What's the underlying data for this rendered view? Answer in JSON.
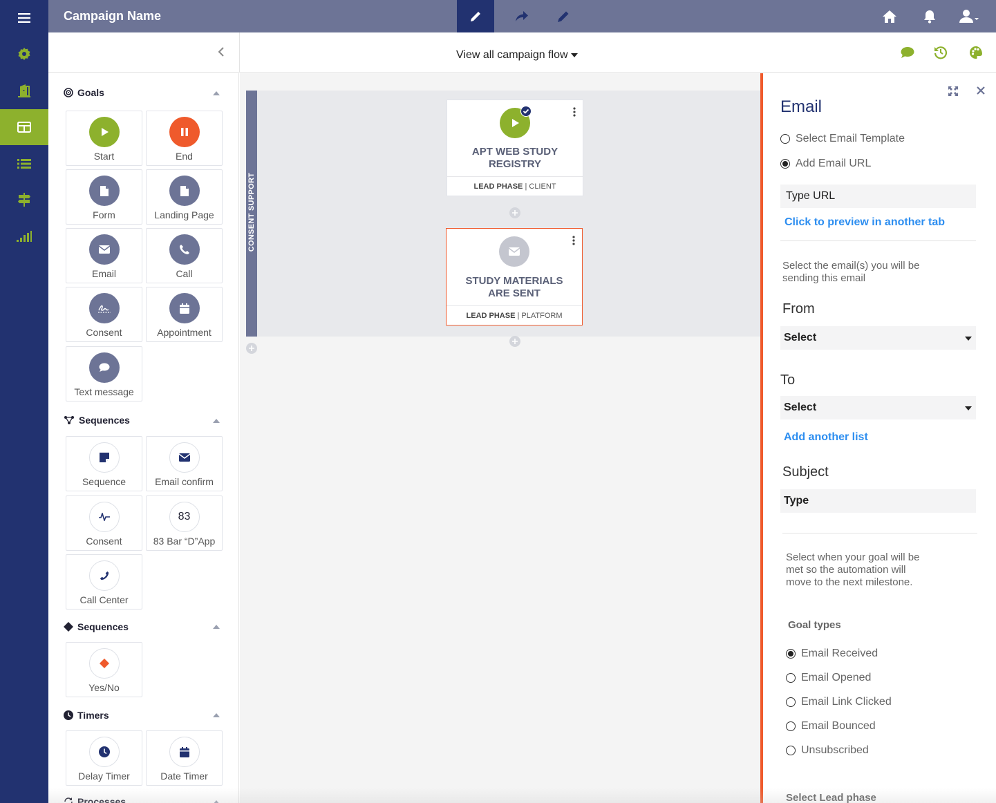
{
  "app": {
    "campaign_name": "Campaign Name",
    "accent_green": "#8db12d",
    "accent_orange": "#ef5a2c",
    "navy": "#223270"
  },
  "rail": {
    "items": [
      "menu-icon",
      "gear-icon",
      "door-icon",
      "board-icon",
      "list-icon",
      "signpost-icon",
      "signal-icon"
    ],
    "active": "board-icon"
  },
  "topbar": {
    "tools": [
      "pencil-icon",
      "share-icon",
      "pen-icon"
    ],
    "right_icons": [
      "home-icon",
      "bell-icon",
      "user-icon"
    ]
  },
  "subheader": {
    "flow_select": "View all campaign flow",
    "right_icons": [
      "comment-icon",
      "history-icon",
      "palette-icon"
    ]
  },
  "sidebar": {
    "goals": {
      "title": "Goals",
      "tiles": [
        "Start",
        "End",
        "Form",
        "Landing Page",
        "Email",
        "Call",
        "Consent",
        "Appointment",
        "Text message"
      ]
    },
    "sequences": {
      "title": "Sequences",
      "tiles": [
        "Sequence",
        "Email confirm",
        "Consent",
        "83 Bar “D”App",
        "Call Center"
      ],
      "badge_83": "83"
    },
    "decisions": {
      "title": "Sequences",
      "tiles": [
        "Yes/No"
      ]
    },
    "timers": {
      "title": "Timers",
      "tiles": [
        "Delay Timer",
        "Date Timer"
      ]
    },
    "processes": {
      "title": "Processes"
    }
  },
  "canvas": {
    "lane_label": "CONSENT SUPPORT",
    "nodes": [
      {
        "title": "APT WEB STUDY REGISTRY",
        "phase": "LEAD PHASE",
        "owner": "CLIENT"
      },
      {
        "title": "STUDY MATERIALS ARE SENT",
        "phase": "LEAD PHASE",
        "owner": "PLATFORM"
      }
    ],
    "separator": "|"
  },
  "panel": {
    "title": "Email",
    "source_options": [
      "Select Email Template",
      "Add Email URL"
    ],
    "selected_source": "Add Email URL",
    "url_field": "Type URL",
    "preview_link": "Click to preview in another tab",
    "select_help": "Select the email(s) you will be sending this email",
    "from_label": "From",
    "from_value": "Select",
    "to_label": "To",
    "to_value": "Select",
    "add_list_link": "Add another list",
    "subject_label": "Subject",
    "subject_value": "Type",
    "goal_help": "Select when your goal will be met so the automation will move to the next milestone.",
    "goal_types_label": "Goal types",
    "goal_types": [
      "Email Received",
      "Email Opened",
      "Email Link Clicked",
      "Email Bounced",
      "Unsubscribed"
    ],
    "selected_goal_type": "Email Received",
    "lead_phase_label": "Select Lead phase"
  }
}
